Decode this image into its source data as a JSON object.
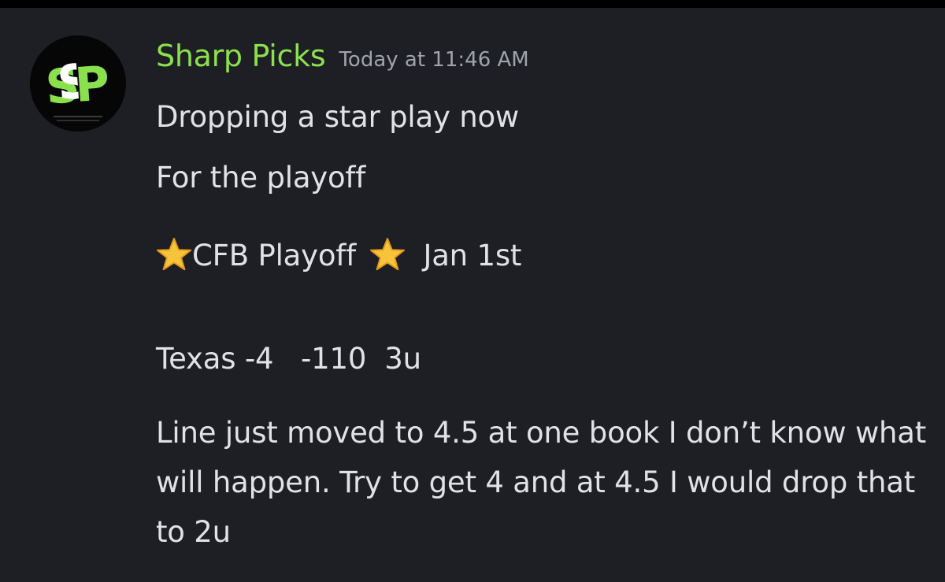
{
  "author": {
    "name": "Sharp Picks",
    "avatar_text": "SP",
    "avatar_icon": "sharp-picks-logo-icon"
  },
  "timestamp": "Today at 11:46 AM",
  "messages": [
    {
      "text": "Dropping a star play now"
    },
    {
      "text": "For the playoff"
    },
    {
      "prefix_icon": "star-emoji-icon",
      "text": "CFB Playoff",
      "suffix_icon": "star-emoji-icon",
      "tail": "Jan 1st"
    },
    {
      "text": "Texas -4   -110  3u"
    },
    {
      "text": "Line just moved to 4.5 at one book I don’t know what will happen. Try to get 4 and at 4.5 I would drop that to 2u"
    }
  ],
  "colors": {
    "background": "#1e1f25",
    "username": "#8be04e",
    "text": "#e1e2e5",
    "timestamp": "#a0a3aa"
  }
}
